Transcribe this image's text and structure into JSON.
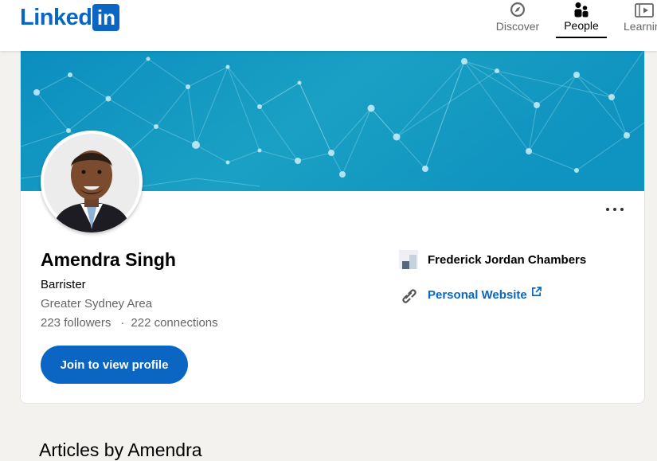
{
  "header": {
    "logo": {
      "text": "Linked",
      "box": "in"
    },
    "nav": [
      {
        "label": "Discover",
        "icon": "compass-icon",
        "active": false
      },
      {
        "label": "People",
        "icon": "people-icon",
        "active": true
      },
      {
        "label": "Learning",
        "icon": "learning-icon",
        "active": false
      }
    ]
  },
  "profile": {
    "name": "Amendra Singh",
    "headline": "Barrister",
    "location": "Greater Sydney Area",
    "followers": "223 followers",
    "separator": "·",
    "connections": "222 connections",
    "join_button": "Join to view profile",
    "company": "Frederick Jordan Chambers",
    "website": "Personal Website"
  },
  "articles": {
    "heading": "Articles by Amendra"
  },
  "colors": {
    "brand": "#0a66c2",
    "banner": "#0e8fc0",
    "background": "#f3f2ef"
  }
}
